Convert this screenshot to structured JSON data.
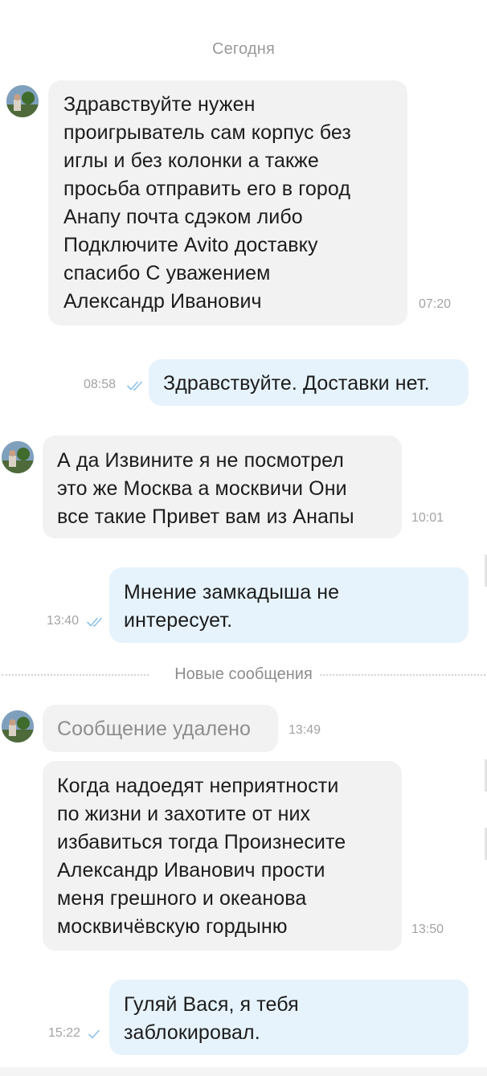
{
  "date_separator": "Сегодня",
  "new_messages_separator": "Новые сообщения",
  "messages": [
    {
      "direction": "incoming",
      "text": "Здравствуйте нужен\nпроигрыватель сам корпус без\nиглы и без колонки а также\nпросьба отправить его в город\nАнапу почта сдэком либо\nПодключите Avito доставку\nспасибо С уважением\nАлександр Иванович",
      "time": "07:20"
    },
    {
      "direction": "outgoing",
      "text": "Здравствуйте. Доставки нет.",
      "time": "08:58",
      "status": "read"
    },
    {
      "direction": "incoming",
      "text": "А да Извините я не посмотрел\nэто же Москва а москвичи Они\nвсе такие Привет вам из Анапы",
      "time": "10:01"
    },
    {
      "direction": "outgoing",
      "text": "Мнение замкадыша не\nинтересует.",
      "time": "13:40",
      "status": "read"
    },
    {
      "direction": "incoming",
      "text": "Сообщение удалено",
      "time": "13:49",
      "deleted": true
    },
    {
      "direction": "incoming",
      "text": "Когда надоедят неприятности\nпо жизни и захотите от них\nизбавиться тогда Произнесите\nАлександр Иванович прости\nменя грешного и океанова\nмосквичёвскую гордыню",
      "time": "13:50"
    },
    {
      "direction": "outgoing",
      "text": "Гуляй Вася, я тебя\nзаблокировал.",
      "time": "15:22",
      "status": "sent"
    }
  ],
  "colors": {
    "incoming_bubble": "#f2f2f2",
    "outgoing_bubble": "#e6f3fc",
    "read_tick": "#8fc2e8",
    "time_text": "#a3a3a3"
  },
  "icons": {
    "avatar": "avatar-photo",
    "read": "double-check-icon",
    "sent": "single-check-icon"
  }
}
